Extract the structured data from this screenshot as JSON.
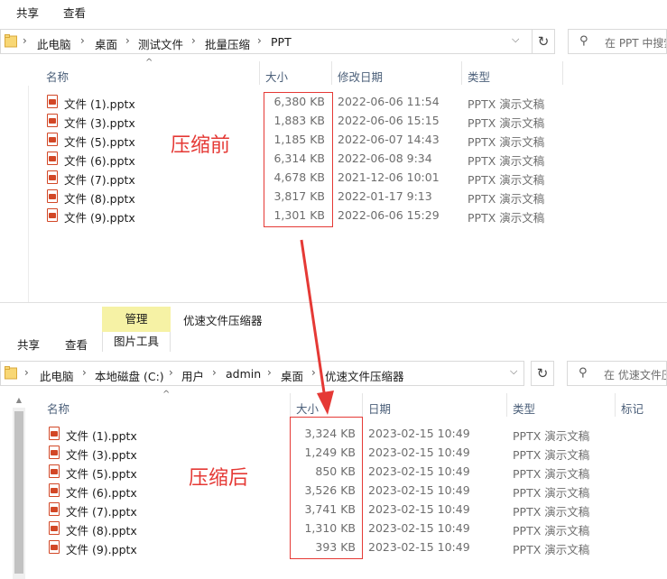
{
  "top": {
    "ribbon": {
      "share": "共享",
      "view": "查看"
    },
    "breadcrumb": [
      "此电脑",
      "桌面",
      "测试文件",
      "批量压缩",
      "PPT"
    ],
    "search_placeholder": "在 PPT 中搜索",
    "columns": {
      "name": "名称",
      "size": "大小",
      "modified": "修改日期",
      "type": "类型"
    },
    "files": [
      {
        "name": "文件 (1).pptx",
        "size": "6,380 KB",
        "date": "2022-06-06 11:54",
        "type": "PPTX 演示文稿"
      },
      {
        "name": "文件 (3).pptx",
        "size": "1,883 KB",
        "date": "2022-06-06 15:15",
        "type": "PPTX 演示文稿"
      },
      {
        "name": "文件 (5).pptx",
        "size": "1,185 KB",
        "date": "2022-06-07 14:43",
        "type": "PPTX 演示文稿"
      },
      {
        "name": "文件 (6).pptx",
        "size": "6,314 KB",
        "date": "2022-06-08 9:34",
        "type": "PPTX 演示文稿"
      },
      {
        "name": "文件 (7).pptx",
        "size": "4,678 KB",
        "date": "2021-12-06 10:01",
        "type": "PPTX 演示文稿"
      },
      {
        "name": "文件 (8).pptx",
        "size": "3,817 KB",
        "date": "2022-01-17 9:13",
        "type": "PPTX 演示文稿"
      },
      {
        "name": "文件 (9).pptx",
        "size": "1,301 KB",
        "date": "2022-06-06 15:29",
        "type": "PPTX 演示文稿"
      }
    ],
    "annotation": "压缩前"
  },
  "bottom": {
    "ribbon": {
      "share": "共享",
      "view": "查看",
      "manage": "管理",
      "picture_tools": "图片工具",
      "window_title": "优速文件压缩器"
    },
    "breadcrumb": [
      "此电脑",
      "本地磁盘 (C:)",
      "用户",
      "admin",
      "桌面",
      "优速文件压缩器"
    ],
    "search_placeholder": "在 优速文件压缩器 中搜索",
    "columns": {
      "name": "名称",
      "size": "大小",
      "date": "日期",
      "type": "类型",
      "tags": "标记"
    },
    "files": [
      {
        "name": "文件 (1).pptx",
        "size": "3,324 KB",
        "date": "2023-02-15 10:49",
        "type": "PPTX 演示文稿"
      },
      {
        "name": "文件 (3).pptx",
        "size": "1,249 KB",
        "date": "2023-02-15 10:49",
        "type": "PPTX 演示文稿"
      },
      {
        "name": "文件 (5).pptx",
        "size": "850 KB",
        "date": "2023-02-15 10:49",
        "type": "PPTX 演示文稿"
      },
      {
        "name": "文件 (6).pptx",
        "size": "3,526 KB",
        "date": "2023-02-15 10:49",
        "type": "PPTX 演示文稿"
      },
      {
        "name": "文件 (7).pptx",
        "size": "3,741 KB",
        "date": "2023-02-15 10:49",
        "type": "PPTX 演示文稿"
      },
      {
        "name": "文件 (8).pptx",
        "size": "1,310 KB",
        "date": "2023-02-15 10:49",
        "type": "PPTX 演示文稿"
      },
      {
        "name": "文件 (9).pptx",
        "size": "393 KB",
        "date": "2023-02-15 10:49",
        "type": "PPTX 演示文稿"
      }
    ],
    "annotation": "压缩后"
  },
  "colors": {
    "annotation_red": "#e53935",
    "manage_tab": "#f6f2a5",
    "header_text": "#4c607a"
  }
}
